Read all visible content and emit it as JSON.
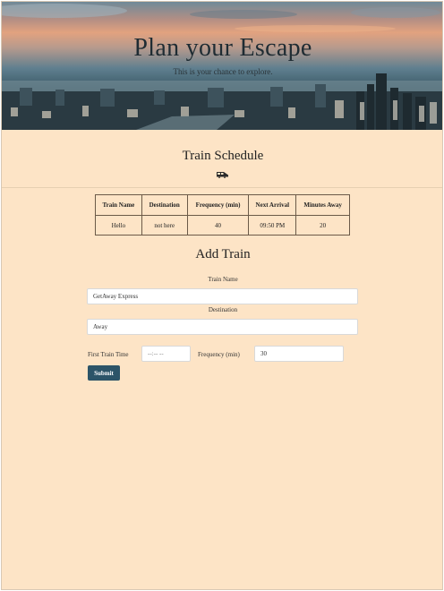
{
  "hero": {
    "title": "Plan your Escape",
    "subtitle": "This is your chance to explore."
  },
  "schedule": {
    "title": "Train Schedule",
    "icon": "train-icon",
    "columns": [
      "Train Name",
      "Destination",
      "Frequency (min)",
      "Next Arrival",
      "Minutes Away"
    ],
    "rows": [
      [
        "Hello",
        "not here",
        "40",
        "09:50 PM",
        "20"
      ]
    ]
  },
  "form": {
    "title": "Add Train",
    "train_name_label": "Train Name",
    "train_name_value": "GetAway Express",
    "destination_label": "Destination",
    "destination_value": "Away",
    "first_time_label": "First Train Time",
    "first_time_placeholder": "--:-- --",
    "frequency_label": "Frequency (min)",
    "frequency_value": "30",
    "submit_label": "Submit"
  },
  "colors": {
    "background": "#fde4c6",
    "button": "#2c5468"
  }
}
